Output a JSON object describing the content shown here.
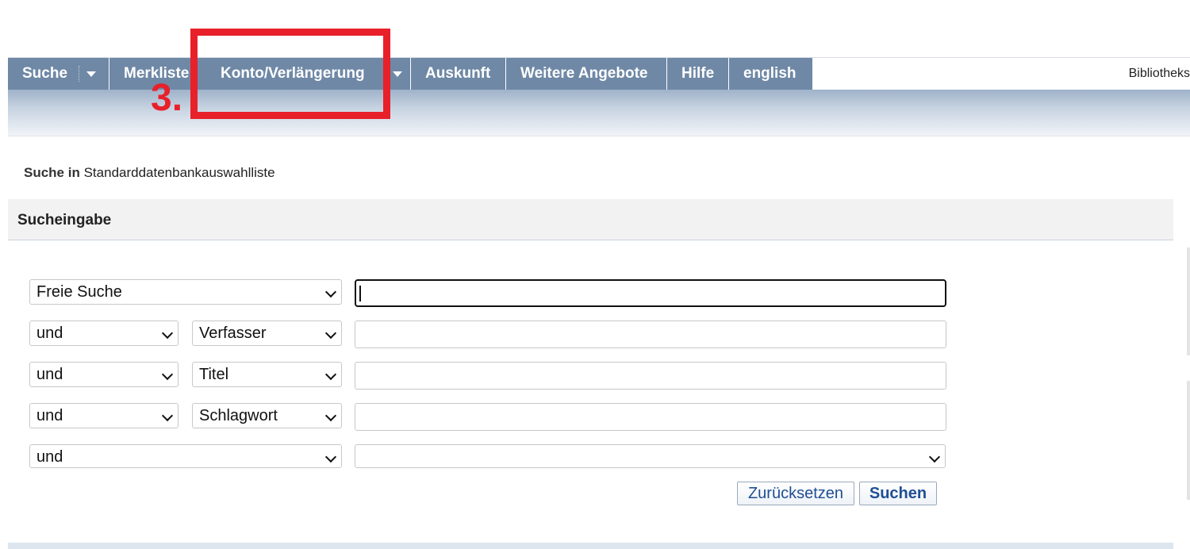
{
  "nav": {
    "items": [
      {
        "label": "Suche",
        "dropdown": true
      },
      {
        "label": "Merkliste",
        "dropdown": false
      },
      {
        "label": "Konto/Verlängerung",
        "dropdown": true
      },
      {
        "label": "Auskunft",
        "dropdown": false
      },
      {
        "label": "Weitere Angebote",
        "dropdown": false
      },
      {
        "label": "Hilfe",
        "dropdown": false
      },
      {
        "label": "english",
        "dropdown": false
      }
    ],
    "right_text": "Bibliotheks"
  },
  "annotation": {
    "number": "3.",
    "color": "#e8202a"
  },
  "search_in": {
    "label": "Suche in",
    "value": "Standarddatenbankauswahlliste"
  },
  "panel": {
    "title": "Sucheingabe"
  },
  "form": {
    "row1": {
      "field": "Freie Suche",
      "value": ""
    },
    "row2": {
      "operator": "und",
      "field": "Verfasser",
      "value": ""
    },
    "row3": {
      "operator": "und",
      "field": "Titel",
      "value": ""
    },
    "row4": {
      "operator": "und",
      "field": "Schlagwort",
      "value": ""
    },
    "row5": {
      "operator": "und",
      "value": ""
    }
  },
  "buttons": {
    "reset": "Zurücksetzen",
    "search": "Suchen"
  },
  "colors": {
    "nav": "#6f88a6",
    "button_text": "#1f4e93"
  }
}
